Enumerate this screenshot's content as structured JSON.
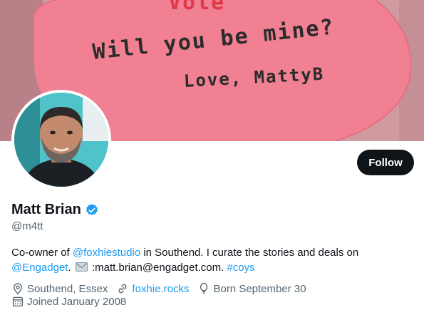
{
  "banner": {
    "top_text": "Vole",
    "line1": "Will you be mine?",
    "line2": "Love, MattyB"
  },
  "profile": {
    "name": "Matt Brian",
    "handle": "@m4tt",
    "follow_label": "Follow",
    "bio": {
      "t1": "Co-owner of ",
      "mention1": "@foxhiestudio",
      "t2": " in Southend. I curate the stories and deals on ",
      "mention2": "@Engadget",
      "t3": ". ",
      "t4": " :matt.brian@engadget.com. ",
      "hashtag": "#coys"
    },
    "location": "Southend, Essex",
    "website": "foxhie.rocks",
    "born": "Born September 30",
    "joined": "Joined January 2008"
  },
  "colors": {
    "accent": "#1d9bf0",
    "text": "#0f1419",
    "secondary": "#536471",
    "banner_pink": "#f07f8e"
  },
  "icons": [
    "verified-badge-icon",
    "mail-icon",
    "location-pin-icon",
    "link-icon",
    "balloon-icon",
    "calendar-icon"
  ]
}
